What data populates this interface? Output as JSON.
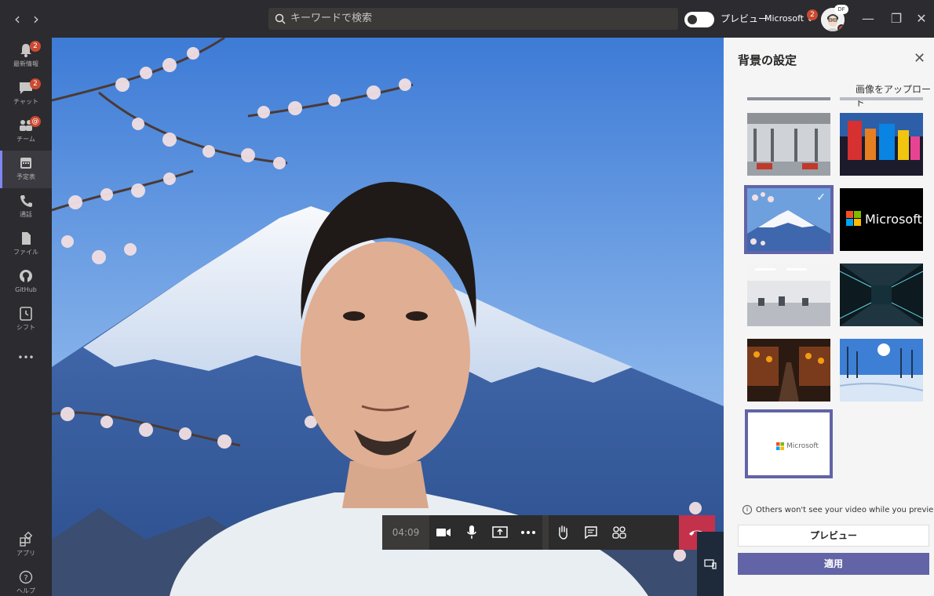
{
  "titlebar": {
    "search_placeholder": "キーワードで検索",
    "preview_toggle_label": "プレビュー",
    "org_name": "Microsoft",
    "org_badge": "2",
    "avatar_initials": "DF"
  },
  "rail": {
    "items": [
      {
        "label": "最新情報",
        "badge": "2",
        "icon": "bell-icon"
      },
      {
        "label": "チャット",
        "badge": "2",
        "icon": "chat-icon"
      },
      {
        "label": "チーム",
        "badge": "@",
        "icon": "teams-icon"
      },
      {
        "label": "予定表",
        "badge": "",
        "icon": "calendar-icon"
      },
      {
        "label": "通話",
        "badge": "",
        "icon": "phone-icon"
      },
      {
        "label": "ファイル",
        "badge": "",
        "icon": "file-icon"
      },
      {
        "label": "GitHub",
        "badge": "",
        "icon": "github-icon"
      },
      {
        "label": "シフト",
        "badge": "",
        "icon": "clock-icon"
      },
      {
        "label": "アプリ",
        "badge": "",
        "icon": "apps-icon"
      },
      {
        "label": "ヘルプ",
        "badge": "",
        "icon": "help-icon"
      }
    ],
    "more_label": "•••"
  },
  "call": {
    "timer": "04:09"
  },
  "panel": {
    "title": "背景の設定",
    "upload_label": "画像をアップロード",
    "tile_text": "Microsoft",
    "upload_tile_text": "Microsoft",
    "info_text": "Others won't see your video while you previe...",
    "preview_button": "プレビュー",
    "apply_button": "適用"
  },
  "colors": {
    "accent": "#6264a7",
    "hangup": "#c4314b",
    "badge": "#cc4a31"
  }
}
